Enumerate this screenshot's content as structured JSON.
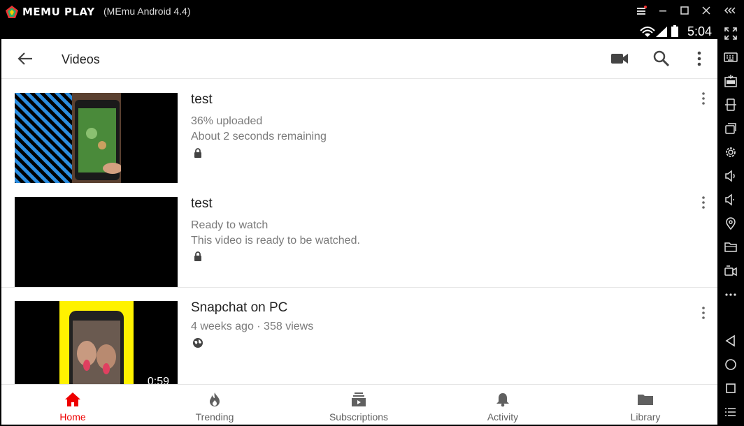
{
  "window": {
    "brand": "MEMU PLAY",
    "subtitle": "(MEmu Android 4.4)"
  },
  "status": {
    "time": "5:04"
  },
  "appbar": {
    "title": "Videos"
  },
  "videos": [
    {
      "title": "test",
      "line1": "36% uploaded",
      "line2": "About 2 seconds remaining",
      "privacy": "lock-icon"
    },
    {
      "title": "test",
      "line1": "Ready to watch",
      "line2": "This video is ready to be watched.",
      "privacy": "lock-icon"
    },
    {
      "title": "Snapchat on PC",
      "line1": "4 weeks ago · 358 views",
      "privacy": "globe-icon",
      "duration": "0:59"
    }
  ],
  "bottom_nav": [
    {
      "label": "Home",
      "active": true
    },
    {
      "label": "Trending"
    },
    {
      "label": "Subscriptions"
    },
    {
      "label": "Activity"
    },
    {
      "label": "Library"
    }
  ],
  "colors": {
    "accent": "#e00000",
    "upload_stripe": "#2b8de0"
  }
}
